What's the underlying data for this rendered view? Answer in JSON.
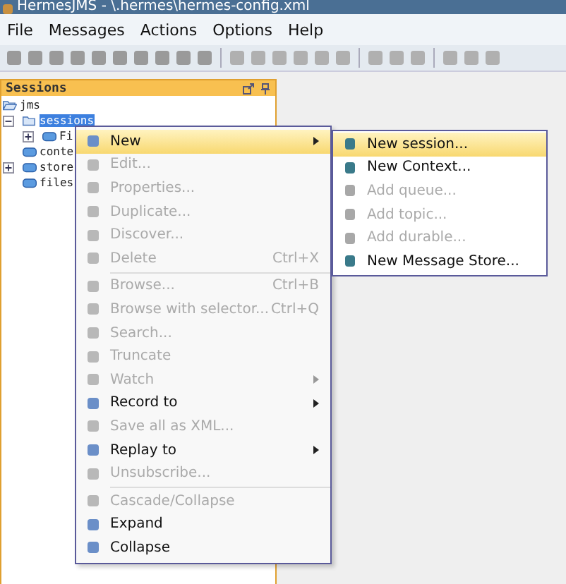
{
  "window": {
    "title": "HermesJMS - \\.hermes\\hermes-config.xml"
  },
  "menu_bar": [
    "File",
    "Messages",
    "Actions",
    "Options",
    "Help"
  ],
  "sessions_panel": {
    "title": "Sessions",
    "tree": [
      {
        "label": "jms",
        "expanded": true,
        "selected": false,
        "children": [
          {
            "label": "sessions",
            "expanded": true,
            "selected": true,
            "children": [
              {
                "label": "Fi",
                "expanded": false,
                "selected": false
              }
            ]
          },
          {
            "label": "conte",
            "selected": false
          },
          {
            "label": "store",
            "expanded": false,
            "selected": false
          },
          {
            "label": "files",
            "selected": false
          }
        ]
      }
    ]
  },
  "context_menu": {
    "items": [
      {
        "kind": "item",
        "label": "New",
        "disabled": false,
        "submenu": true,
        "selected": true
      },
      {
        "kind": "item",
        "label": "Edit...",
        "disabled": true,
        "submenu": false,
        "selected": false
      },
      {
        "kind": "item",
        "label": "Properties...",
        "disabled": true,
        "submenu": false,
        "selected": false
      },
      {
        "kind": "item",
        "label": "Duplicate...",
        "disabled": true,
        "submenu": false,
        "selected": false
      },
      {
        "kind": "item",
        "label": "Discover...",
        "disabled": true,
        "submenu": false,
        "selected": false
      },
      {
        "kind": "item",
        "label": "Delete",
        "shortcut": "Ctrl+X",
        "disabled": true,
        "submenu": false,
        "selected": false
      },
      {
        "kind": "separator"
      },
      {
        "kind": "item",
        "label": "Browse...",
        "shortcut": "Ctrl+B",
        "disabled": true,
        "submenu": false,
        "selected": false
      },
      {
        "kind": "item",
        "label": "Browse with selector...",
        "shortcut": "Ctrl+Q",
        "disabled": true,
        "submenu": false,
        "selected": false
      },
      {
        "kind": "item",
        "label": "Search...",
        "disabled": true,
        "submenu": false,
        "selected": false
      },
      {
        "kind": "item",
        "label": "Truncate",
        "disabled": true,
        "submenu": false,
        "selected": false
      },
      {
        "kind": "item",
        "label": "Watch",
        "disabled": true,
        "submenu": true,
        "selected": false
      },
      {
        "kind": "item",
        "label": "Record to",
        "disabled": false,
        "submenu": true,
        "selected": false
      },
      {
        "kind": "item",
        "label": "Save all as XML...",
        "disabled": true,
        "submenu": false,
        "selected": false
      },
      {
        "kind": "item",
        "label": "Replay to",
        "disabled": false,
        "submenu": true,
        "selected": false
      },
      {
        "kind": "item",
        "label": "Unsubscribe...",
        "disabled": true,
        "submenu": false,
        "selected": false
      },
      {
        "kind": "separator"
      },
      {
        "kind": "item",
        "label": "Cascade/Collapse",
        "disabled": true,
        "submenu": false,
        "selected": false
      },
      {
        "kind": "item",
        "label": "Expand",
        "disabled": false,
        "submenu": false,
        "selected": false
      },
      {
        "kind": "item",
        "label": "Collapse",
        "disabled": false,
        "submenu": false,
        "selected": false
      }
    ]
  },
  "submenu": {
    "items": [
      {
        "label": "New session...",
        "disabled": false,
        "selected": true
      },
      {
        "label": "New Context...",
        "disabled": false,
        "selected": false
      },
      {
        "label": "Add queue...",
        "disabled": true,
        "selected": false
      },
      {
        "label": "Add topic...",
        "disabled": true,
        "selected": false
      },
      {
        "label": "Add durable...",
        "disabled": true,
        "selected": false
      },
      {
        "label": "New Message Store...",
        "disabled": false,
        "selected": false
      }
    ]
  }
}
